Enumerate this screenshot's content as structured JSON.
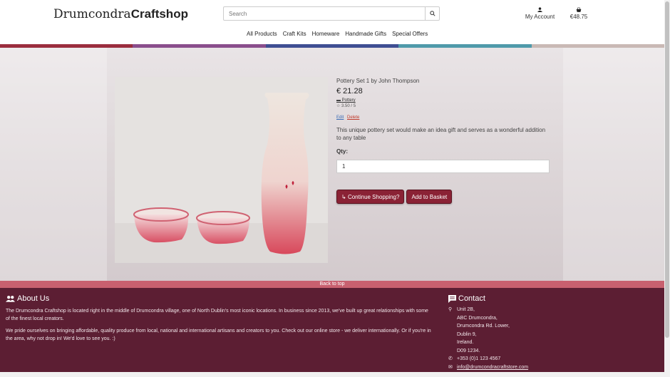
{
  "header": {
    "logo_light": "Drumcondra",
    "logo_bold": "Craftshop",
    "search_placeholder": "Search",
    "account_label": "My Account",
    "basket_total": "€48.75"
  },
  "nav": {
    "items": [
      {
        "label": "All Products"
      },
      {
        "label": "Craft Kits"
      },
      {
        "label": "Homeware"
      },
      {
        "label": "Handmade Gifts"
      },
      {
        "label": "Special Offers"
      }
    ]
  },
  "stripe_colors": [
    "#9b2d3e",
    "#8a4e8c",
    "#3f4f93",
    "#4f9aaa",
    "#c9b9b5"
  ],
  "product": {
    "title": "Pottery Set 1 by John Thompson",
    "price": "€ 21.28",
    "category": "Pottery",
    "rating": "3.50 / 5",
    "edit_label": "Edit",
    "delete_label": "Delete",
    "description": "This unique pottery set would make an idea gift and serves as a wonderful addition to any table",
    "qty_label": "Qty:",
    "qty_value": "1",
    "continue_label": "Continue Shopping?",
    "add_label": "Add to Basket"
  },
  "back_to_top": "Back to top",
  "footer": {
    "about_title": "About Us",
    "about_p1": "The Drumcondra Craftshop is located right in the middle of Drumcondra village, one of North Dublin's most iconic locations. In business since 2013, we've built up great relationships with some of the finest local creators.",
    "about_p2": "We pride ourselves on bringing affordable, quality produce from local, national and international artisans and creators to you. Check out our online store - we deliver internationally. Or if you're in the area, why not drop in! We'd love to see you. :)",
    "contact_title": "Contact",
    "address": [
      "Unit 2B,",
      "ABC Drumcondra,",
      "Drumcondra Rd. Lower,",
      "Dublin 9,",
      "Ireland.",
      "D09 1234."
    ],
    "phone": "+353 (0)1 123 4567",
    "email": "info@drumcondracraftstore.com"
  },
  "colors": {
    "accent": "#8a2235",
    "footer": "#5c1e33",
    "back_to_top": "#c8606f"
  }
}
